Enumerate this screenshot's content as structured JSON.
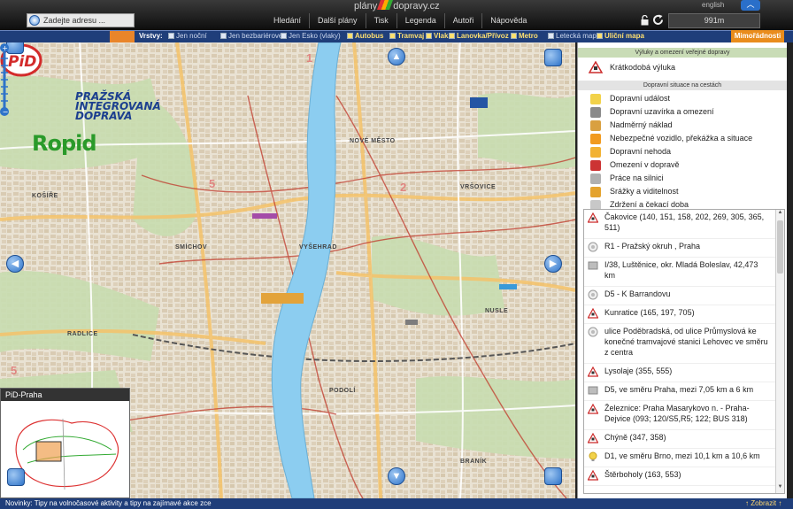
{
  "header": {
    "logo_prefix": "plány",
    "logo_suffix": "dopravy.cz",
    "language": "english",
    "address_placeholder": "Zadejte adresu ...",
    "menu": [
      "Hledání",
      "Další plány",
      "Tisk",
      "Legenda",
      "Autoři",
      "Nápověda"
    ],
    "scale": "991m"
  },
  "layers": {
    "title": "Vrstvy:",
    "items": [
      {
        "label": "Jen noční",
        "on": false
      },
      {
        "label": "Jen bezbariérové",
        "on": false
      },
      {
        "label": "Jen Esko (vlaky)",
        "on": false
      },
      {
        "label": "Autobus",
        "on": true
      },
      {
        "label": "Tramvaj",
        "on": true
      },
      {
        "label": "Vlak",
        "on": true
      },
      {
        "label": "Lanovka/Přívoz",
        "on": true
      },
      {
        "label": "Metro",
        "on": true
      },
      {
        "label": "Letecká mapa",
        "on": false
      },
      {
        "label": "Uliční mapa",
        "on": true
      }
    ],
    "extraordinary": "Mimořádnosti"
  },
  "map": {
    "pid_line1": "PRAŽSKÁ",
    "pid_line2": "INTEGROVANÁ",
    "pid_line3": "DOPRAVA",
    "ropid": "Ropid",
    "labels": [
      "NOVÉ MĚSTO",
      "VYŠEHRAD",
      "SMÍCHOV",
      "PODOLÍ",
      "RADLICE",
      "NUSLE",
      "BRANÍK",
      "VRŠOVICE",
      "KOŠÍŘE"
    ],
    "minimap_title": "PiD-Praha"
  },
  "legend": {
    "section1": "Výluky a omezení veřejné dopravy",
    "outage": "Krátkodobá výluka",
    "section2": "Dopravní situace na cestách",
    "items": [
      {
        "label": "Dopravní událost",
        "color": "#f2d24a"
      },
      {
        "label": "Dopravní uzavírka a omezení",
        "color": "#8a8a8a"
      },
      {
        "label": "Nadměrný náklad",
        "color": "#d9a040"
      },
      {
        "label": "Nebezpečné vozidlo, překážka a situace",
        "color": "#f19a1f"
      },
      {
        "label": "Dopravní nehoda",
        "color": "#f2b233"
      },
      {
        "label": "Omezení v dopravě",
        "color": "#cc3333"
      },
      {
        "label": "Práce na silnici",
        "color": "#b0b0b0"
      },
      {
        "label": "Srážky a viditelnost",
        "color": "#e4a32e"
      },
      {
        "label": "Zdržení a čekací doba",
        "color": "#c8c8c8"
      }
    ]
  },
  "events": [
    {
      "icon": "warning-icon",
      "text": "Čakovice (140, 151, 158, 202, 269, 305, 365, 511)"
    },
    {
      "icon": "roadwork-icon",
      "text": "R1 - Pražský okruh , Praha"
    },
    {
      "icon": "closure-icon",
      "text": "I/38, Luštěnice, okr. Mladá Boleslav, 42,473 km"
    },
    {
      "icon": "roadwork-icon",
      "text": "D5 - K Barrandovu"
    },
    {
      "icon": "warning-icon",
      "text": "Kunratice (165, 197, 705)"
    },
    {
      "icon": "roadwork-icon",
      "text": "ulice Poděbradská, od ulice Průmyslová ke konečné tramvajové stanici Lehovec ve směru z centra"
    },
    {
      "icon": "warning-icon",
      "text": "Lysolaje (355, 555)"
    },
    {
      "icon": "closure-icon",
      "text": "D5, ve směru Praha, mezi 7,05 km a 6 km"
    },
    {
      "icon": "warning-icon",
      "text": "Železnice: Praha Masarykovo n. - Praha-Dejvice (093; 120/S5,R5; 122; BUS 318)"
    },
    {
      "icon": "warning-icon",
      "text": "Chýně (347, 358)"
    },
    {
      "icon": "event-icon",
      "text": "D1, ve směru Brno, mezi 10,1 km a 10,6 km"
    },
    {
      "icon": "warning-icon",
      "text": "Štěrboholy (163, 553)"
    }
  ],
  "footer": {
    "news": "Novinky: Tipy na volnočasové aktivity a tipy na zajímavé akce zce",
    "show": "↑ Zobrazit ↑"
  }
}
